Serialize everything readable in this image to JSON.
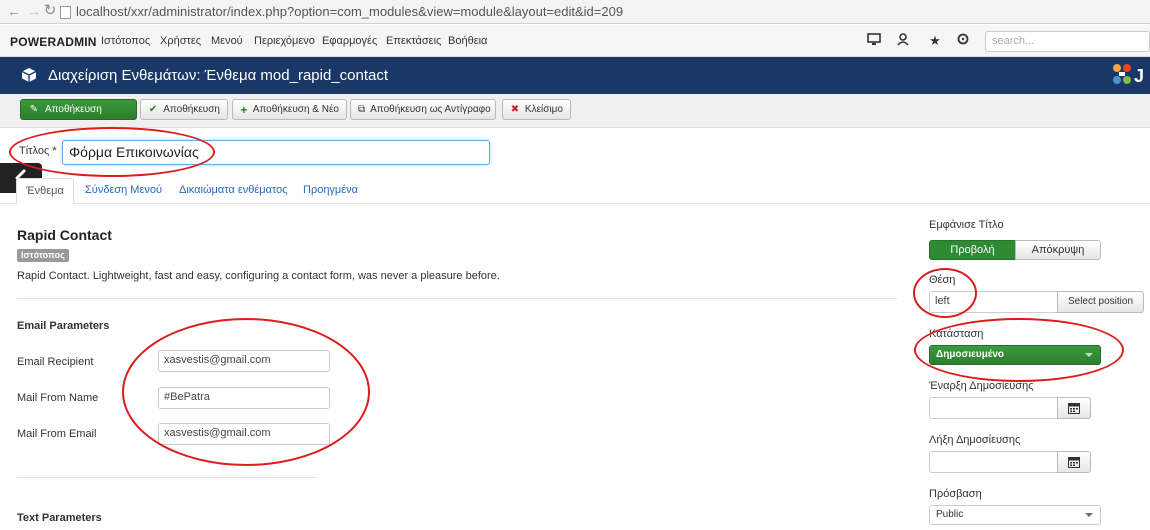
{
  "browser": {
    "url": "localhost/xxr/administrator/index.php?option=com_modules&view=module&layout=edit&id=209"
  },
  "topmenu": {
    "brand": "POWERADMIN",
    "items": [
      "Ιστότοπος",
      "Χρήστες",
      "Μενού",
      "Περιεχόμενο",
      "Εφαρμογές",
      "Επεκτάσεις",
      "Βοήθεια"
    ],
    "search_placeholder": "search..."
  },
  "header": {
    "title": "Διαχείριση Ενθεμάτων: Ένθεμα mod_rapid_contact",
    "logo_text": "J"
  },
  "toolbar": {
    "save": "Αποθήκευση",
    "save_close": "Αποθήκευση",
    "save_new": "Αποθήκευση & Νέο",
    "save_copy": "Αποθήκευση ως Αντίγραφο",
    "close": "Κλείσιμο"
  },
  "title_field": {
    "label": "Τίτλος *",
    "value": "Φόρμα Επικοινωνίας"
  },
  "tabs": [
    "Ένθεμα",
    "Σύνδεση Μενού",
    "Δικαιώματα ενθέματος",
    "Προηγμένα"
  ],
  "module": {
    "name": "Rapid Contact",
    "badge": "Ιστότοπος",
    "description": "Rapid Contact. Lightweight, fast and easy, configuring a contact form, was never a pleasure before."
  },
  "email_params": {
    "heading": "Email Parameters",
    "fields": [
      {
        "label": "Email Recipient",
        "value": "xasvestis@gmail.com"
      },
      {
        "label": "Mail From Name",
        "value": "#BePatra"
      },
      {
        "label": "Mail From Email",
        "value": "xasvestis@gmail.com"
      }
    ]
  },
  "text_params": {
    "heading": "Text Parameters"
  },
  "sidebar": {
    "show_title_label": "Εμφάνισε Τίτλο",
    "show_label": "Προβολή",
    "hide_label": "Απόκρυψη",
    "position_label": "Θέση",
    "position_value": "left",
    "select_position": "Select position",
    "status_label": "Κατάσταση",
    "status_value": "Δημοσιευμένο",
    "publish_up_label": "Έναρξη Δημοσίευσης",
    "publish_down_label": "Λήξη Δημοσίευσης",
    "access_label": "Πρόσβαση",
    "access_value": "Public"
  },
  "colors": {
    "header_bg": "#1a3867",
    "save_green": "#2e8b34",
    "annotation_red": "#dd1c1c"
  }
}
